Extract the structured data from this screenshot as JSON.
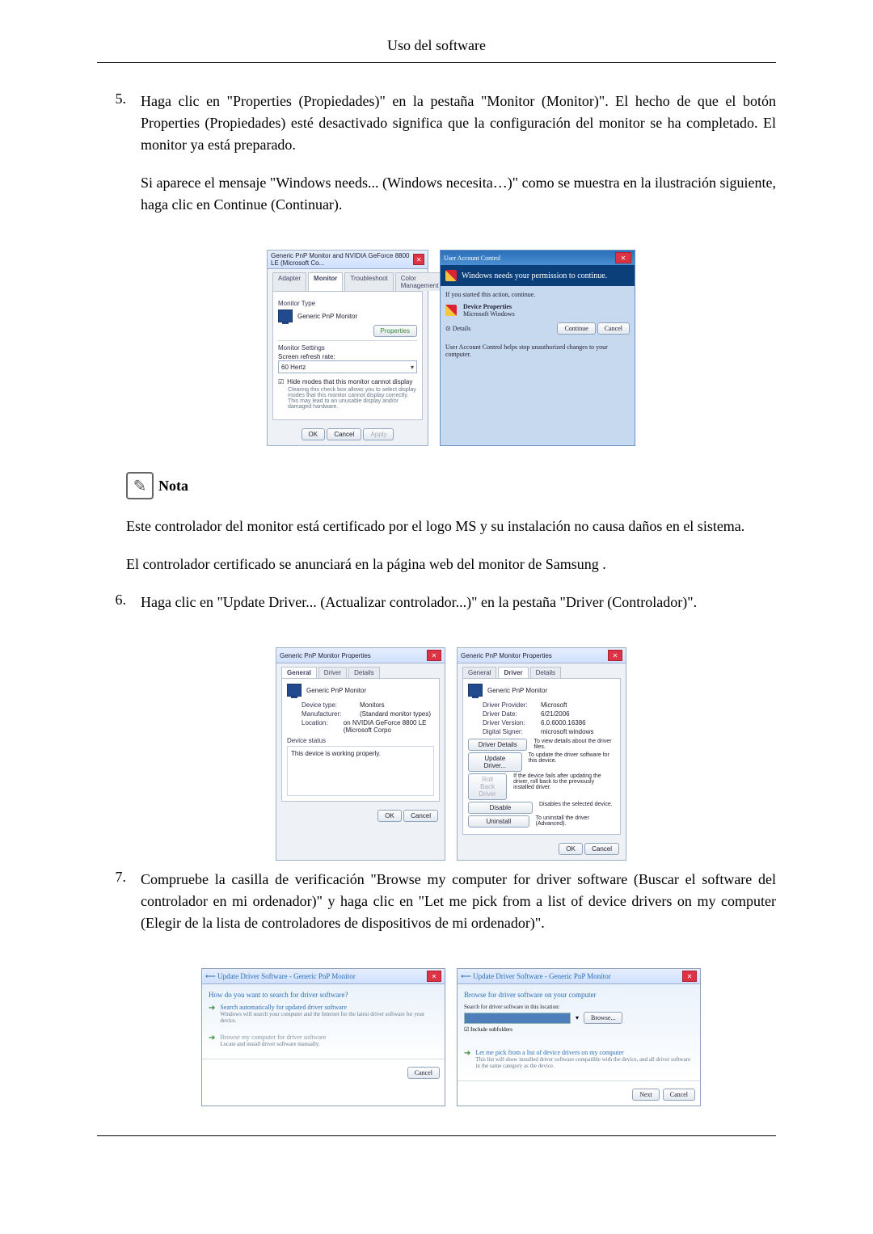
{
  "header": {
    "title": "Uso del software"
  },
  "steps": [
    {
      "num": "5.",
      "paras": [
        "Haga clic en \"Properties (Propiedades)\" en la pestaña \"Monitor (Monitor)\". El hecho de que el botón Properties (Propiedades) esté desactivado significa que la configuración del monitor se ha completado. El monitor ya está preparado.",
        "Si aparece el mensaje \"Windows needs... (Windows necesita…)\" como se muestra en la ilustración siguiente, haga clic en Continue (Continuar)."
      ]
    },
    {
      "num": "6.",
      "paras": [
        "Haga clic en \"Update Driver... (Actualizar controlador...)\" en la pestaña \"Driver (Controlador)\"."
      ]
    },
    {
      "num": "7.",
      "paras": [
        "Compruebe la casilla de verificación \"Browse my computer for driver software (Buscar el software del controlador en mi ordenador)\" y haga clic en \"Let me pick from a list of device drivers on my computer (Elegir de la lista de controladores de dispositivos de mi ordenador)\"."
      ]
    }
  ],
  "note": {
    "label": "Nota",
    "paras": [
      "Este controlador del monitor está certificado por el logo MS y su instalación no causa daños en el sistema.",
      "El controlador certificado se anunciará en la página web del monitor de Samsung ."
    ]
  },
  "figA": {
    "win_title": "Generic PnP Monitor and NVIDIA GeForce 8800 LE (Microsoft Co...",
    "tabs": [
      "Adapter",
      "Monitor",
      "Troubleshoot",
      "Color Management"
    ],
    "monitor_type_label": "Monitor Type",
    "monitor_name": "Generic PnP Monitor",
    "properties_btn": "Properties",
    "settings_label": "Monitor Settings",
    "refresh_label": "Screen refresh rate:",
    "refresh_value": "60 Hertz",
    "hide_modes": "Hide modes that this monitor cannot display",
    "hide_modes_desc": "Clearing this check box allows you to select display modes that this monitor cannot display correctly. This may lead to an unusable display and/or damaged hardware.",
    "ok": "OK",
    "cancel": "Cancel",
    "apply": "Apply"
  },
  "figB": {
    "bar_title": "User Account Control",
    "banner": "Windows needs your permission to continue.",
    "if_started": "If you started this action, continue.",
    "item_title": "Device Properties",
    "item_pub": "Microsoft Windows",
    "details": "Details",
    "continue": "Continue",
    "cancel": "Cancel",
    "footer": "User Account Control helps stop unauthorized changes to your computer."
  },
  "figC": {
    "win_title": "Generic PnP Monitor Properties",
    "tabs": [
      "General",
      "Driver",
      "Details"
    ],
    "monitor_name": "Generic PnP Monitor",
    "kv": [
      {
        "k": "Device type:",
        "v": "Monitors"
      },
      {
        "k": "Manufacturer:",
        "v": "(Standard monitor types)"
      },
      {
        "k": "Location:",
        "v": "on NVIDIA GeForce 8800 LE (Microsoft Corpo"
      }
    ],
    "status_label": "Device status",
    "status_text": "This device is working properly.",
    "ok": "OK",
    "cancel": "Cancel"
  },
  "figD": {
    "win_title": "Generic PnP Monitor Properties",
    "tabs": [
      "General",
      "Driver",
      "Details"
    ],
    "monitor_name": "Generic PnP Monitor",
    "kv": [
      {
        "k": "Driver Provider:",
        "v": "Microsoft"
      },
      {
        "k": "Driver Date:",
        "v": "6/21/2006"
      },
      {
        "k": "Driver Version:",
        "v": "6.0.6000.16386"
      },
      {
        "k": "Digital Signer:",
        "v": "microsoft windows"
      }
    ],
    "buttons": [
      {
        "b": "Driver Details",
        "d": "To view details about the driver files."
      },
      {
        "b": "Update Driver...",
        "d": "To update the driver software for this device."
      },
      {
        "b": "Roll Back Driver",
        "d": "If the device fails after updating the driver, roll back to the previously installed driver."
      },
      {
        "b": "Disable",
        "d": "Disables the selected device."
      },
      {
        "b": "Uninstall",
        "d": "To uninstall the driver (Advanced)."
      }
    ],
    "ok": "OK",
    "cancel": "Cancel"
  },
  "figE": {
    "back": "Update Driver Software - Generic PnP Monitor",
    "heading": "How do you want to search for driver software?",
    "opt1": "Search automatically for updated driver software",
    "opt1d": "Windows will search your computer and the Internet for the latest driver software for your device.",
    "opt2": "Browse my computer for driver software",
    "opt2d": "Locate and install driver software manually.",
    "cancel": "Cancel"
  },
  "figF": {
    "back": "Update Driver Software - Generic PnP Monitor",
    "heading": "Browse for driver software on your computer",
    "loc_label": "Search for driver software in this location:",
    "browse": "Browse...",
    "include": "Include subfolders",
    "opt": "Let me pick from a list of device drivers on my computer",
    "optd": "This list will show installed driver software compatible with the device, and all driver software in the same category as the device.",
    "next": "Next",
    "cancel": "Cancel"
  }
}
